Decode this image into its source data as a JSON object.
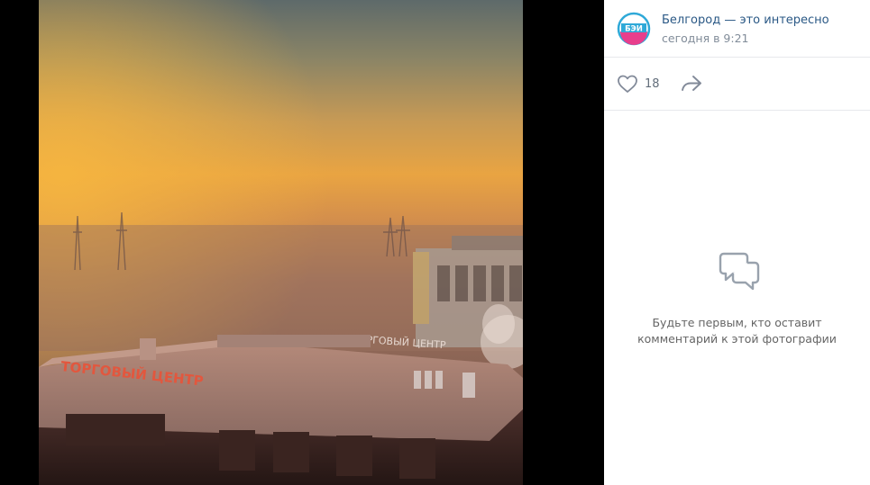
{
  "post": {
    "author": "Белгород — это интересно",
    "date": "сегодня в 9:21",
    "avatar_text": "БЭИ"
  },
  "actions": {
    "likes_count": "18"
  },
  "comments": {
    "empty_text": "Будьте первым, кто оставит\nкомментарий к этой фотографии"
  },
  "photo": {
    "sign_left": "ТОРГОВЫЙ ЦЕНТР",
    "sign_right": "ТОРГОВЫЙ ЦЕНТР"
  },
  "colors": {
    "link": "#2a5885",
    "meta": "#818c99",
    "icon": "#828a99"
  }
}
